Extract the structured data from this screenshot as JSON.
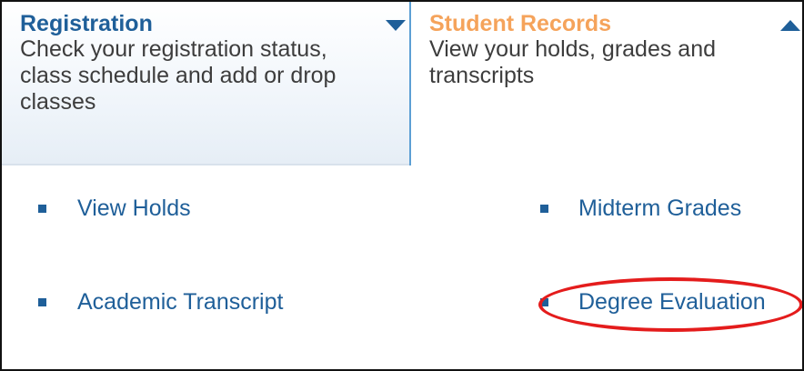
{
  "tabs": {
    "registration": {
      "title": "Registration",
      "description": "Check your registration status, class schedule and add or drop classes",
      "arrow_icon": "chevron-down-icon"
    },
    "student_records": {
      "title": "Student Records",
      "description": "View your holds, grades and transcripts",
      "arrow_icon": "chevron-up-icon"
    }
  },
  "links": [
    {
      "label": "View Holds"
    },
    {
      "label": "Midterm Grades"
    },
    {
      "label": "Academic Transcript"
    },
    {
      "label": "Degree Evaluation"
    }
  ],
  "annotation": {
    "highlighted_link": "Degree Evaluation",
    "color": "#e41c1c"
  },
  "colors": {
    "link_blue": "#1f5f99",
    "active_tab_orange": "#f5a35b",
    "text_gray": "#3d3d3d"
  }
}
